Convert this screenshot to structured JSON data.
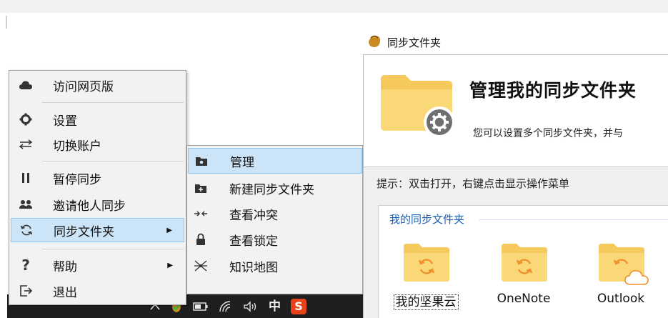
{
  "context_menu": {
    "items": [
      {
        "label": "访问网页版",
        "icon": "cloud-icon"
      },
      {
        "label": "设置",
        "icon": "gear-icon"
      },
      {
        "label": "切换账户",
        "icon": "swap-icon"
      },
      {
        "label": "暂停同步",
        "icon": "pause-icon"
      },
      {
        "label": "邀请他人同步",
        "icon": "users-icon"
      },
      {
        "label": "同步文件夹",
        "icon": "sync-icon"
      },
      {
        "label": "帮助",
        "icon": "question-icon"
      },
      {
        "label": "退出",
        "icon": "exit-icon"
      }
    ],
    "active_item": "同步文件夹"
  },
  "submenu": {
    "items": [
      {
        "label": "管理",
        "icon": "folder-manage-icon"
      },
      {
        "label": "新建同步文件夹",
        "icon": "folder-add-icon"
      },
      {
        "label": "查看冲突",
        "icon": "conflict-icon"
      },
      {
        "label": "查看锁定",
        "icon": "lock-icon"
      },
      {
        "label": "知识地图",
        "icon": "mindmap-icon"
      }
    ],
    "active_item": "管理"
  },
  "taskbar": {
    "ime_label": "中",
    "tray_icons": [
      "chevron-up-icon",
      "nutstore-tray-icon",
      "battery-icon",
      "wifi-icon",
      "volume-icon",
      "sogou-icon"
    ],
    "sogou_label": "S"
  },
  "sync_window": {
    "title": "同步文件夹",
    "header_title": "管理我的同步文件夹",
    "header_desc": "您可以设置多个同步文件夹，并与",
    "hint": "提示：双击打开，右键点击显示操作菜单",
    "group_label": "我的同步文件夹",
    "folders": [
      {
        "name": "我的坚果云",
        "selected": true,
        "badge": "sync"
      },
      {
        "name": "OneNote",
        "selected": false,
        "badge": "sync"
      },
      {
        "name": "Outlook",
        "selected": false,
        "badge": "cloud"
      }
    ]
  },
  "colors": {
    "menu_background": "#f2f2f2",
    "menu_highlight": "#cce4f7",
    "folder_yellow": "#f9d26b",
    "sync_orange": "#f0912c",
    "group_label_blue": "#1a5fb4",
    "taskbar": "#1f1f1f"
  }
}
